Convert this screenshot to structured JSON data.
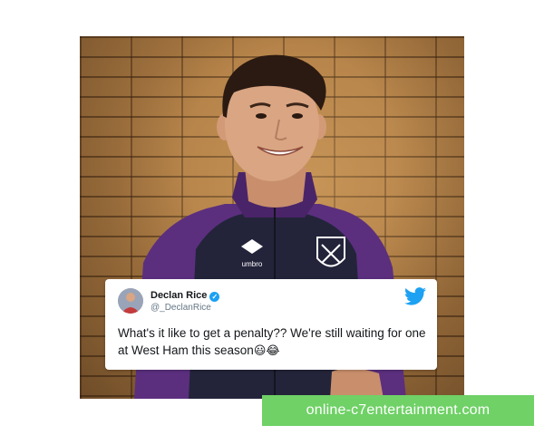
{
  "tweet": {
    "author_name": "Declan Rice",
    "author_handle": "@_DeclanRice",
    "text": "What's it like to get a penalty?? We're still waiting for one at West Ham this season",
    "emojis": "😃😂",
    "verified_icon": "checkmark",
    "brand_icon": "twitter-bird"
  },
  "photo": {
    "jacket_brand": "umbro",
    "colors": {
      "brick": "#b07e45",
      "jacket_purple": "#5b2f7e",
      "vest_navy": "#23243a",
      "skin": "#d9a583",
      "hair": "#2b1a12"
    }
  },
  "watermark": {
    "text": "online-c7entertainment.com",
    "background": "#6fd166"
  }
}
